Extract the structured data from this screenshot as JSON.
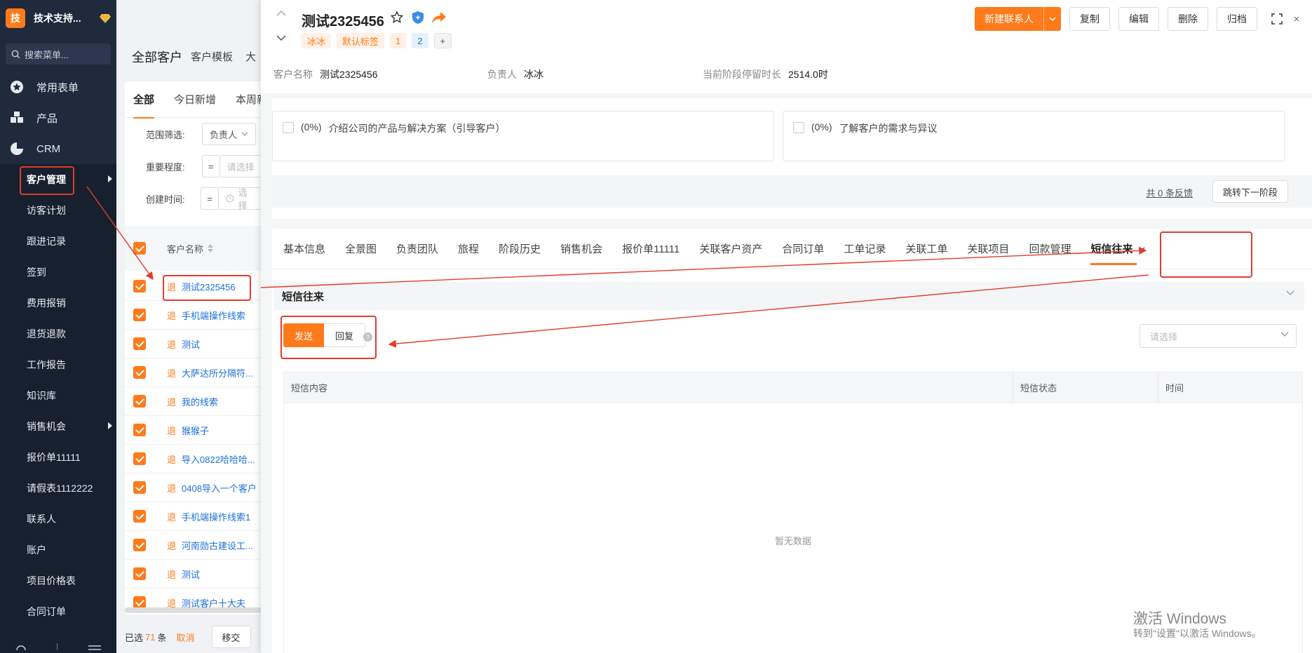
{
  "brand": {
    "logo_char": "技",
    "name": "技术支持..."
  },
  "sidebar": {
    "search_placeholder": "搜索菜单...",
    "top_items": [
      {
        "label": "常用表单",
        "icon": "star-icon"
      },
      {
        "label": "产品",
        "icon": "grid-icon"
      },
      {
        "label": "CRM",
        "icon": "pie-icon"
      }
    ],
    "crm_items": [
      {
        "label": "客户管理",
        "has_arrow": true
      },
      {
        "label": "访客计划"
      },
      {
        "label": "跟进记录"
      },
      {
        "label": "签到"
      },
      {
        "label": "费用报销"
      },
      {
        "label": "退货退款"
      },
      {
        "label": "工作报告"
      },
      {
        "label": "知识库"
      },
      {
        "label": "销售机会",
        "has_arrow": true
      },
      {
        "label": "报价单11111"
      },
      {
        "label": "请假表1112222"
      },
      {
        "label": "联系人"
      },
      {
        "label": "账户"
      },
      {
        "label": "项目价格表"
      },
      {
        "label": "合同订单"
      }
    ]
  },
  "list": {
    "title": "全部客户",
    "template": "客户模板",
    "template_more": "大",
    "tabs": [
      "全部",
      "今日新增",
      "本周新"
    ],
    "filters": [
      {
        "label": "范围筛选:",
        "value": "负责人"
      },
      {
        "label": "重要程度:",
        "op": "=",
        "placeholder": "请选择"
      },
      {
        "label": "创建时间:",
        "op": "=",
        "placeholder": "选择"
      }
    ],
    "column": "客户名称",
    "row_tag": "退",
    "rows": [
      "测试2325456",
      "手机端操作线索",
      "测试",
      "大萨达所分隔符...",
      "我的线索",
      "猴猴子",
      "导入0822哈哈哈...",
      "0408导入一个客户",
      "手机端操作线索1",
      "河南勋古建设工...",
      "测试",
      "测试客户十大夫"
    ],
    "footer": {
      "selected_prefix": "已选",
      "count": "71",
      "suffix": "条",
      "cancel": "取消",
      "move": "移交"
    }
  },
  "detail": {
    "title": "测试2325456",
    "tags": [
      {
        "label": "冰冰",
        "style": "orange"
      },
      {
        "label": "默认标签",
        "style": "orange"
      },
      {
        "label": "1",
        "style": "orange"
      },
      {
        "label": "2",
        "style": "blue"
      },
      {
        "label": "+",
        "style": "plus"
      }
    ],
    "actions": {
      "new_contact": "新建联系人",
      "copy": "复制",
      "edit": "编辑",
      "delete": "删除",
      "archive": "归档"
    },
    "info": [
      {
        "key": "客户名称",
        "value": "测试2325456"
      },
      {
        "key": "负责人",
        "value": "冰冰"
      },
      {
        "key": "当前阶段停留时长",
        "value": "2514.0时"
      }
    ],
    "stages": [
      {
        "percent": "(0%)",
        "text": "介绍公司的产品与解决方案（引导客户）"
      },
      {
        "percent": "(0%)",
        "text": "了解客户的需求与异议"
      }
    ],
    "feedback": "共 0 条反馈",
    "next_stage": "跳转下一阶段",
    "tabs": [
      "基本信息",
      "全景图",
      "负责团队",
      "旅程",
      "阶段历史",
      "销售机会",
      "报价单11111",
      "关联客户资产",
      "合同订单",
      "工单记录",
      "关联工单",
      "关联项目",
      "回款管理",
      "短信往来"
    ],
    "active_tab": "短信往来",
    "section_title": "短信往来",
    "toggle": {
      "send": "发送",
      "reply": "回复"
    },
    "select_placeholder": "请选择",
    "columns": [
      "短信内容",
      "短信状态",
      "时间"
    ],
    "empty_text": "暂无数据"
  },
  "watermark": {
    "line1": "激活 Windows",
    "line2": "转到\"设置\"以激活 Windows。"
  },
  "colors": {
    "accent": "#ff7a1a",
    "sidebar": "#1f2a3c",
    "annotation": "#e23c2b",
    "link": "#1d6fd8"
  }
}
